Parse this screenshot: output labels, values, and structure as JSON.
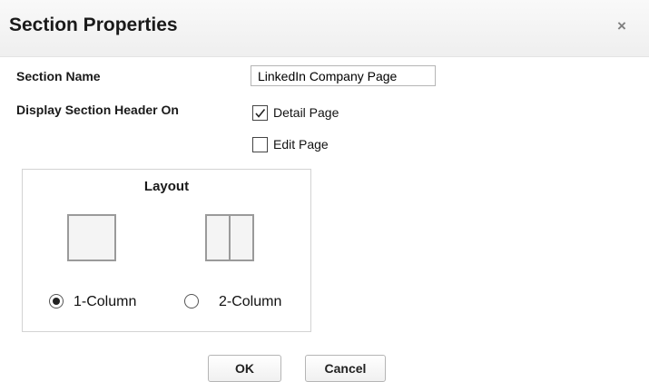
{
  "dialog": {
    "title": "Section Properties",
    "close_glyph": "×",
    "close_icon": "close-icon"
  },
  "form": {
    "section_name_label": "Section Name",
    "section_name_value": "LinkedIn Company Page",
    "display_header_label": "Display Section Header On",
    "options": [
      {
        "label": "Detail Page",
        "checked": true
      },
      {
        "label": "Edit Page",
        "checked": false
      }
    ]
  },
  "layout": {
    "title": "Layout",
    "options": [
      {
        "label": "1-Column",
        "selected": true,
        "icon": "single-column-icon"
      },
      {
        "label": "2-Column",
        "selected": false,
        "icon": "two-column-icon"
      }
    ]
  },
  "buttons": {
    "ok": "OK",
    "cancel": "Cancel"
  },
  "colors": {
    "header_bg": "#f3f3f3",
    "icon_border": "#9a9a9a"
  }
}
